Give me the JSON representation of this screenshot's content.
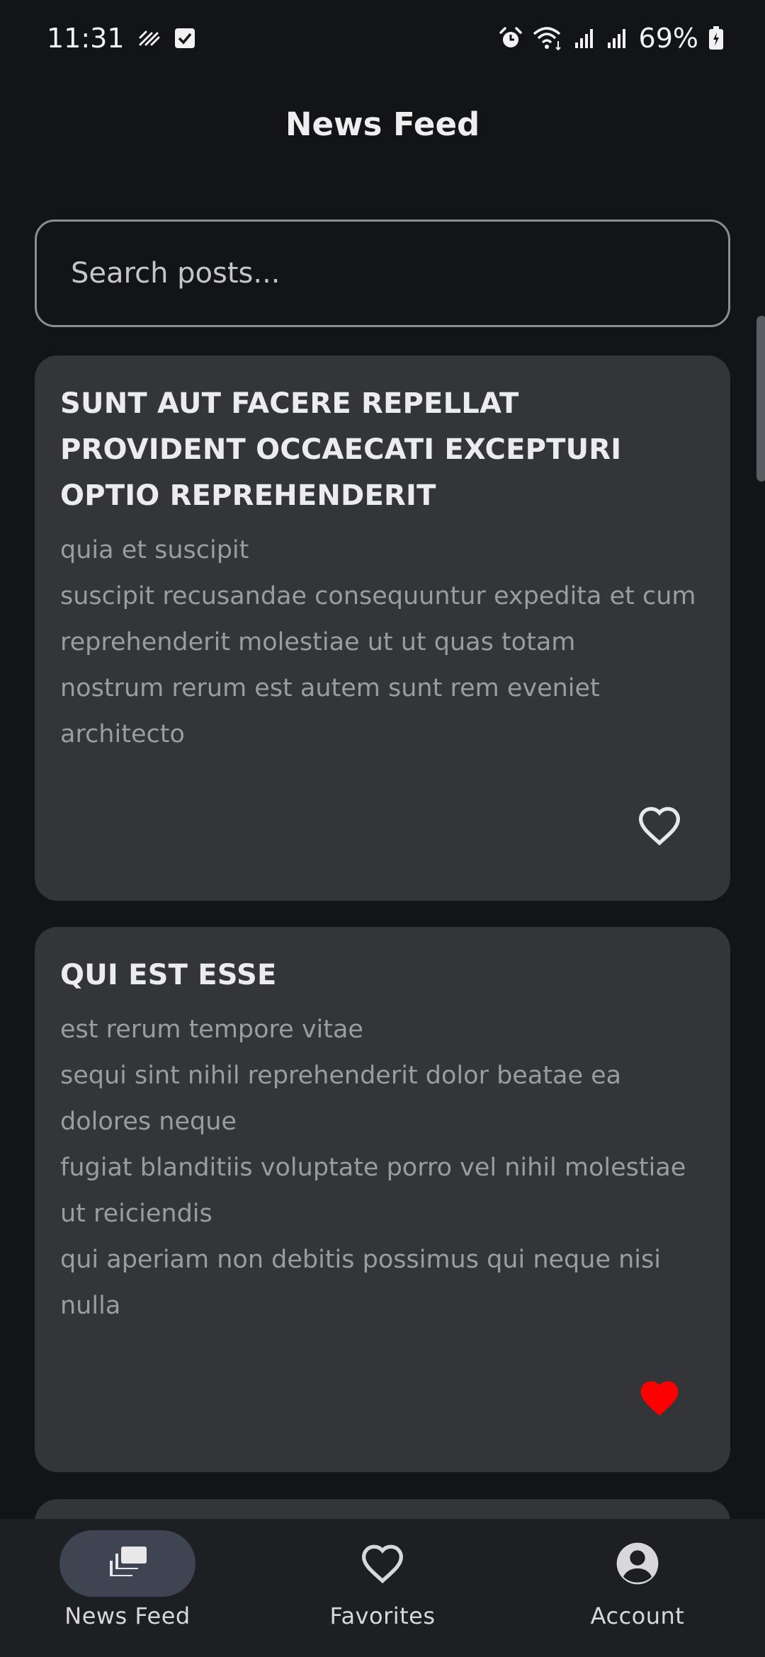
{
  "status_bar": {
    "time": "11:31",
    "battery": "69%",
    "icons": [
      "activity-icon",
      "check-box-icon",
      "alarm-icon",
      "wifi-icon",
      "signal-icon",
      "signal-icon",
      "battery-charging-icon"
    ]
  },
  "header": {
    "title": "News Feed"
  },
  "search": {
    "placeholder": "Search posts..."
  },
  "posts": [
    {
      "title": "SUNT AUT FACERE REPELLAT PROVIDENT OCCAECATI EXCEPTURI OPTIO REPREHENDERIT",
      "body": "quia et suscipit\nsuscipit recusandae consequuntur expedita et cum reprehenderit molestiae ut ut quas totam\nnostrum rerum est autem sunt rem eveniet architecto",
      "favorited": false
    },
    {
      "title": "QUI EST ESSE",
      "body": "est rerum tempore vitae\nsequi sint nihil reprehenderit dolor beatae ea dolores neque\nfugiat blanditiis voluptate porro vel nihil molestiae ut reiciendis\nqui aperiam non debitis possimus qui neque nisi nulla",
      "favorited": true
    }
  ],
  "bottom_nav": {
    "items": [
      {
        "label": "News Feed",
        "icon": "feed-icon",
        "active": true
      },
      {
        "label": "Favorites",
        "icon": "heart-outline-icon",
        "active": false
      },
      {
        "label": "Account",
        "icon": "account-circle-icon",
        "active": false
      }
    ]
  },
  "colors": {
    "background": "#131418",
    "card": "#343539",
    "favorite_active": "#ff0000",
    "nav_active_pill": "#3f4453"
  }
}
